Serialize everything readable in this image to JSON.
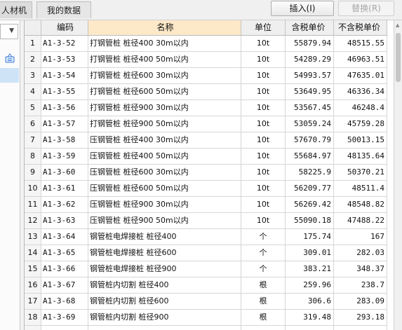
{
  "tabs": [
    {
      "label": "人材机"
    },
    {
      "label": "我的数据"
    }
  ],
  "toolbar": {
    "insert_label": "插入(I)",
    "replace_label": "替换(R)"
  },
  "table": {
    "headers": {
      "code": "编码",
      "name": "名称",
      "unit": "单位",
      "price_tax": "含税单价",
      "price_notax": "不含税单价"
    },
    "rows": [
      {
        "idx": "1",
        "code": "A1-3-52",
        "name": "打钢管桩 桩径400 30m以内",
        "unit": "10t",
        "price_tax": "55879.94",
        "price_notax": "48515.55"
      },
      {
        "idx": "2",
        "code": "A1-3-53",
        "name": "打钢管桩 桩径400 50m以内",
        "unit": "10t",
        "price_tax": "54289.29",
        "price_notax": "46963.51"
      },
      {
        "idx": "3",
        "code": "A1-3-54",
        "name": "打钢管桩 桩径600 30m以内",
        "unit": "10t",
        "price_tax": "54993.57",
        "price_notax": "47635.01"
      },
      {
        "idx": "4",
        "code": "A1-3-55",
        "name": "打钢管桩 桩径600 50m以内",
        "unit": "10t",
        "price_tax": "53649.95",
        "price_notax": "46336.34"
      },
      {
        "idx": "5",
        "code": "A1-3-56",
        "name": "打钢管桩 桩径900 30m以内",
        "unit": "10t",
        "price_tax": "53567.45",
        "price_notax": "46248.4"
      },
      {
        "idx": "6",
        "code": "A1-3-57",
        "name": "打钢管桩 桩径900 50m以内",
        "unit": "10t",
        "price_tax": "53059.24",
        "price_notax": "45759.28"
      },
      {
        "idx": "7",
        "code": "A1-3-58",
        "name": "压钢管桩 桩径400 30m以内",
        "unit": "10t",
        "price_tax": "57670.79",
        "price_notax": "50013.15"
      },
      {
        "idx": "8",
        "code": "A1-3-59",
        "name": "压钢管桩 桩径400 50m以内",
        "unit": "10t",
        "price_tax": "55684.97",
        "price_notax": "48135.64"
      },
      {
        "idx": "9",
        "code": "A1-3-60",
        "name": "压钢管桩 桩径600 30m以内",
        "unit": "10t",
        "price_tax": "58225.9",
        "price_notax": "50370.21"
      },
      {
        "idx": "10",
        "code": "A1-3-61",
        "name": "压钢管桩 桩径600 50m以内",
        "unit": "10t",
        "price_tax": "56209.77",
        "price_notax": "48511.4"
      },
      {
        "idx": "11",
        "code": "A1-3-62",
        "name": "压钢管桩 桩径900 30m以内",
        "unit": "10t",
        "price_tax": "56269.42",
        "price_notax": "48548.82"
      },
      {
        "idx": "12",
        "code": "A1-3-63",
        "name": "压钢管桩 桩径900 50m以内",
        "unit": "10t",
        "price_tax": "55090.18",
        "price_notax": "47488.22"
      },
      {
        "idx": "13",
        "code": "A1-3-64",
        "name": "钢管桩电焊接桩 桩径400",
        "unit": "个",
        "price_tax": "175.74",
        "price_notax": "167"
      },
      {
        "idx": "14",
        "code": "A1-3-65",
        "name": "钢管桩电焊接桩 桩径600",
        "unit": "个",
        "price_tax": "309.01",
        "price_notax": "282.03"
      },
      {
        "idx": "15",
        "code": "A1-3-66",
        "name": "钢管桩电焊接桩 桩径900",
        "unit": "个",
        "price_tax": "383.21",
        "price_notax": "348.37"
      },
      {
        "idx": "16",
        "code": "A1-3-67",
        "name": "钢管桩内切割 桩径400",
        "unit": "根",
        "price_tax": "259.96",
        "price_notax": "238.7"
      },
      {
        "idx": "17",
        "code": "A1-3-68",
        "name": "钢管桩内切割 桩径600",
        "unit": "根",
        "price_tax": "306.6",
        "price_notax": "283.09"
      },
      {
        "idx": "18",
        "code": "A1-3-69",
        "name": "钢管桩内切割 桩径900",
        "unit": "根",
        "price_tax": "319.48",
        "price_notax": "293.18"
      }
    ]
  },
  "icons": {
    "dropdown": "chevron-down-icon",
    "filter": "basket-icon"
  }
}
